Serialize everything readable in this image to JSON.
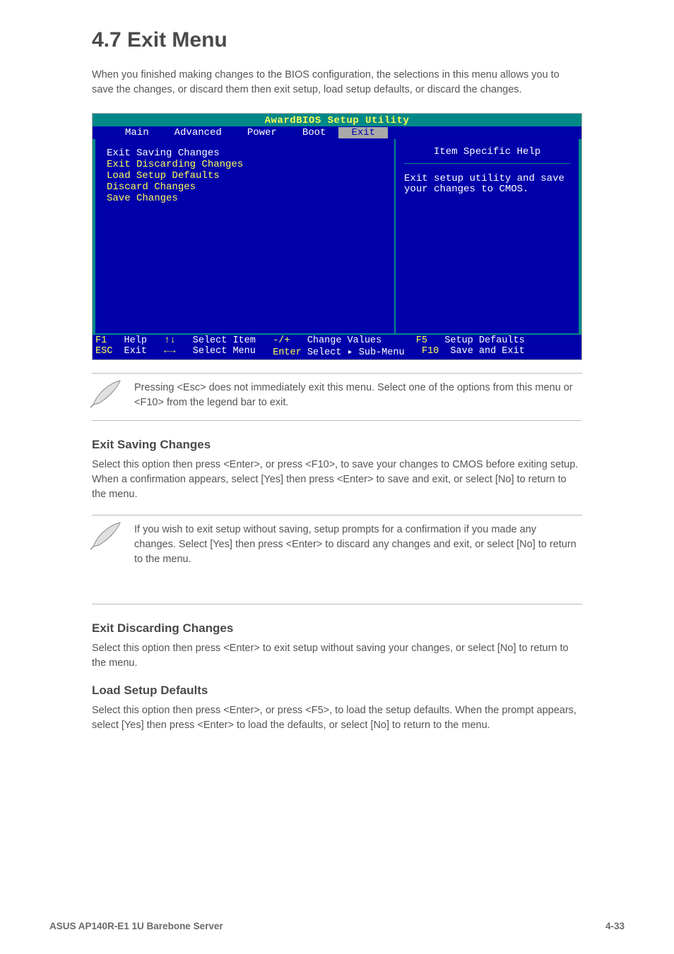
{
  "heading": "4.7  Exit Menu",
  "intro": "When you finished making changes to the BIOS configuration, the selections in this menu allows you to save the changes, or discard them then exit setup, load setup defaults, or discard the changes.",
  "bios": {
    "title": "AwardBIOS Setup Utility",
    "tabs": [
      "Main",
      "Advanced",
      "Power",
      "Boot",
      "Exit"
    ],
    "selected_tab": "Exit",
    "items": [
      "Exit Saving Changes",
      "Exit Discarding Changes",
      "Load Setup Defaults",
      "Discard Changes",
      "Save Changes"
    ],
    "selected_item_index": 0,
    "help_title": "Item Specific Help",
    "help_text": "Exit setup utility and save your changes to CMOS.",
    "footer_rows": [
      [
        {
          "key": "F1",
          "label": "Help"
        },
        {
          "key": "↑↓",
          "label": "Select Item"
        },
        {
          "key": "-/+",
          "label": "Change Values"
        },
        {
          "key": "F5",
          "label": "Setup Defaults"
        }
      ],
      [
        {
          "key": "ESC",
          "label": "Exit"
        },
        {
          "key": "←→",
          "label": "Select Menu"
        },
        {
          "key": "Enter",
          "label": "Select ▸ Sub-Menu"
        },
        {
          "key": "F10",
          "label": "Save and Exit"
        }
      ]
    ]
  },
  "note1": "Pressing <Esc> does not immediately exit this menu. Select one of the options from this menu or <F10> from the legend bar to exit.",
  "section1": {
    "label": "Exit Saving Changes",
    "body": "Select this option then press <Enter>, or press <F10>, to save your changes to CMOS before exiting setup. When a confirmation appears, select [Yes] then press <Enter> to save and exit, or select [No] to return to the menu."
  },
  "note2": "If you wish to exit setup without saving, setup prompts for a confirmation if you made any changes. Select [Yes] then press <Enter> to discard any changes and exit, or select [No] to return to the menu.",
  "section2": {
    "label": "Exit Discarding Changes",
    "body": "Select this option then press <Enter> to exit setup without saving your changes, or select [No] to return to the menu."
  },
  "section3": {
    "label": "Load Setup Defaults",
    "body": "Select this option then press <Enter>, or press <F5>, to load the setup defaults. When the prompt appears, select [Yes] then press <Enter> to load the defaults, or select [No] to return to the menu."
  },
  "footer": {
    "left": "ASUS AP140R-E1 1U Barebone Server",
    "right": "4-33"
  }
}
